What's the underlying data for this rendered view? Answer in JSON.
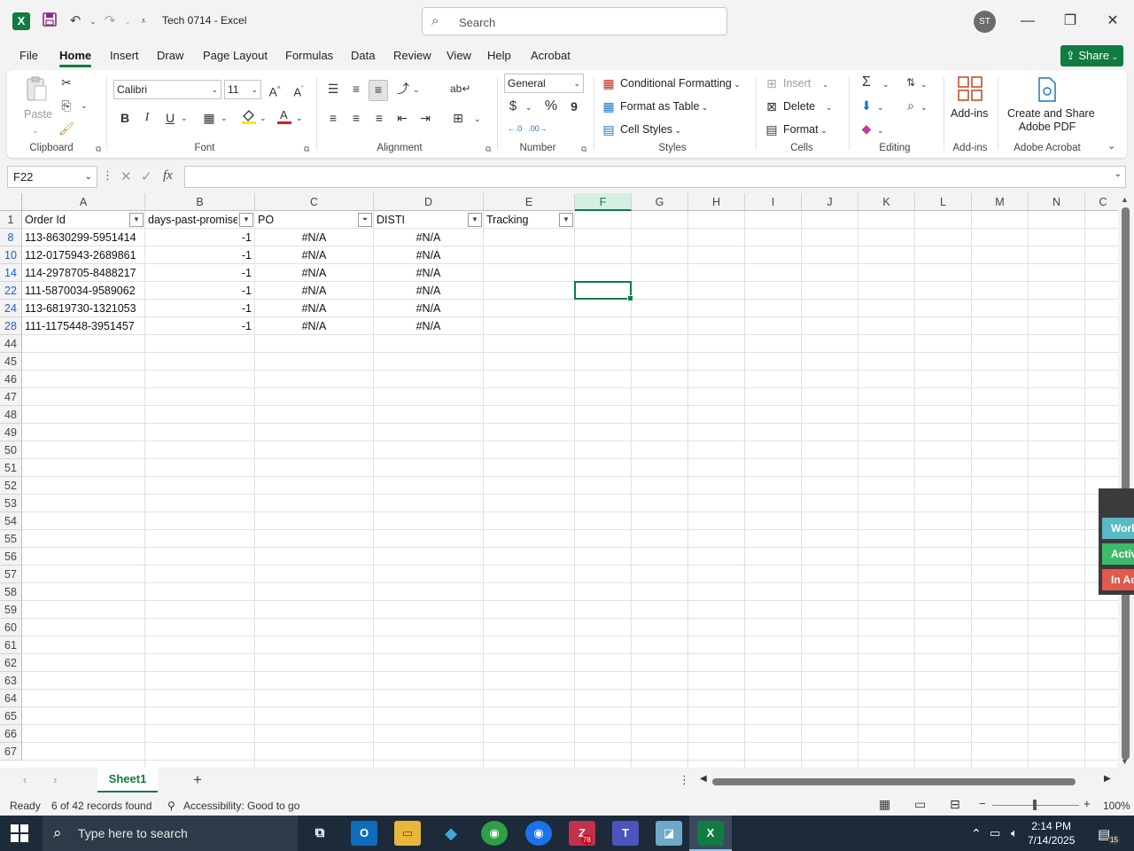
{
  "window": {
    "title": "Tech 0714  -  Excel",
    "search_placeholder": "Search",
    "avatar_initials": "ST"
  },
  "menu": {
    "tabs": [
      "File",
      "Home",
      "Insert",
      "Draw",
      "Page Layout",
      "Formulas",
      "Data",
      "Review",
      "View",
      "Help",
      "Acrobat"
    ],
    "active": "Home",
    "share_label": "Share"
  },
  "ribbon": {
    "clipboard": {
      "paste": "Paste",
      "label": "Clipboard"
    },
    "font": {
      "name": "Calibri",
      "size": "11",
      "bold": "B",
      "italic": "I",
      "underline": "U",
      "label": "Font"
    },
    "alignment": {
      "label": "Alignment"
    },
    "number": {
      "format": "General",
      "currency": "$",
      "percent": "%",
      "comma": "9",
      "label": "Number"
    },
    "styles": {
      "conditional": "Conditional Formatting",
      "table": "Format as Table",
      "cell_styles": "Cell Styles",
      "label": "Styles"
    },
    "cells": {
      "insert": "Insert",
      "delete": "Delete",
      "format": "Format",
      "label": "Cells"
    },
    "editing": {
      "label": "Editing"
    },
    "addins": {
      "button": "Add-ins",
      "label": "Add-ins"
    },
    "acrobat": {
      "button_line1": "Create and Share",
      "button_line2": "Adobe PDF",
      "label": "Adobe Acrobat"
    }
  },
  "formula_bar": {
    "name_box": "F22",
    "fx": "fx",
    "value": ""
  },
  "sheet": {
    "columns": [
      "A",
      "B",
      "C",
      "D",
      "E",
      "F",
      "G",
      "H",
      "I",
      "J",
      "K",
      "L",
      "M",
      "N",
      "C"
    ],
    "selected_column": "F",
    "headers": [
      "Order Id",
      "days-past-promise",
      "PO",
      "DISTI",
      "Tracking"
    ],
    "header_row_number": "1",
    "data_rows": [
      {
        "row": "8",
        "order_id": "113-8630299-5951414",
        "days": "-1",
        "po": "#N/A",
        "disti": "#N/A"
      },
      {
        "row": "10",
        "order_id": "112-0175943-2689861",
        "days": "-1",
        "po": "#N/A",
        "disti": "#N/A"
      },
      {
        "row": "14",
        "order_id": "114-2978705-8488217",
        "days": "-1",
        "po": "#N/A",
        "disti": "#N/A"
      },
      {
        "row": "22",
        "order_id": "111-5870034-9589062",
        "days": "-1",
        "po": "#N/A",
        "disti": "#N/A"
      },
      {
        "row": "24",
        "order_id": "113-6819730-1321053",
        "days": "-1",
        "po": "#N/A",
        "disti": "#N/A"
      },
      {
        "row": "28",
        "order_id": "111-1175448-3951457",
        "days": "-1",
        "po": "#N/A",
        "disti": "#N/A"
      }
    ],
    "empty_rows": [
      "44",
      "45",
      "46",
      "47",
      "48",
      "49",
      "50",
      "51",
      "52",
      "53",
      "54",
      "55",
      "56",
      "57",
      "58",
      "59",
      "60",
      "61",
      "62",
      "63",
      "64",
      "65",
      "66",
      "67"
    ],
    "tab_name": "Sheet1"
  },
  "side_panel": {
    "items": [
      "Worl",
      "Activ",
      "In Ac"
    ],
    "colors": [
      "#5bb8c4",
      "#3dbb6a",
      "#e05a4f"
    ]
  },
  "status": {
    "ready": "Ready",
    "records": "6 of 42 records found",
    "accessibility": "Accessibility: Good to go",
    "zoom": "100%"
  },
  "taskbar": {
    "search_placeholder": "Type here to search",
    "time": "2:14 PM",
    "date": "7/14/2025",
    "zoom_badge": "78",
    "notifications": "15"
  },
  "colors": {
    "accent": "#107c41",
    "taskbar": "#1c2a3a"
  }
}
